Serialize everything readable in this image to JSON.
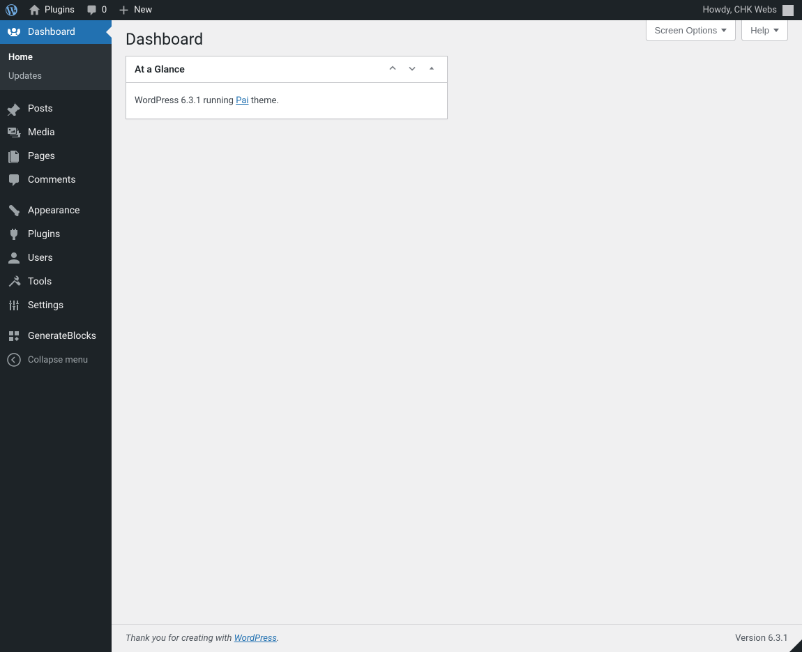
{
  "adminbar": {
    "site_name": "Plugins",
    "comment_count": "0",
    "new_label": "New",
    "greeting": "Howdy, CHK Webs"
  },
  "sidebar": {
    "dashboard": "Dashboard",
    "submenu": {
      "home": "Home",
      "updates": "Updates"
    },
    "posts": "Posts",
    "media": "Media",
    "pages": "Pages",
    "comments": "Comments",
    "appearance": "Appearance",
    "plugins": "Plugins",
    "users": "Users",
    "tools": "Tools",
    "settings": "Settings",
    "generateblocks": "GenerateBlocks",
    "collapse": "Collapse menu"
  },
  "main": {
    "screen_options": "Screen Options",
    "help": "Help",
    "title": "Dashboard",
    "glance": {
      "title": "At a Glance",
      "text_pre": "WordPress 6.3.1 running ",
      "theme_link": "Pai",
      "text_post": " theme."
    }
  },
  "footer": {
    "thanks_pre": "Thank you for creating with ",
    "wp_link": "WordPress",
    "thanks_post": ".",
    "version": "Version 6.3.1"
  }
}
